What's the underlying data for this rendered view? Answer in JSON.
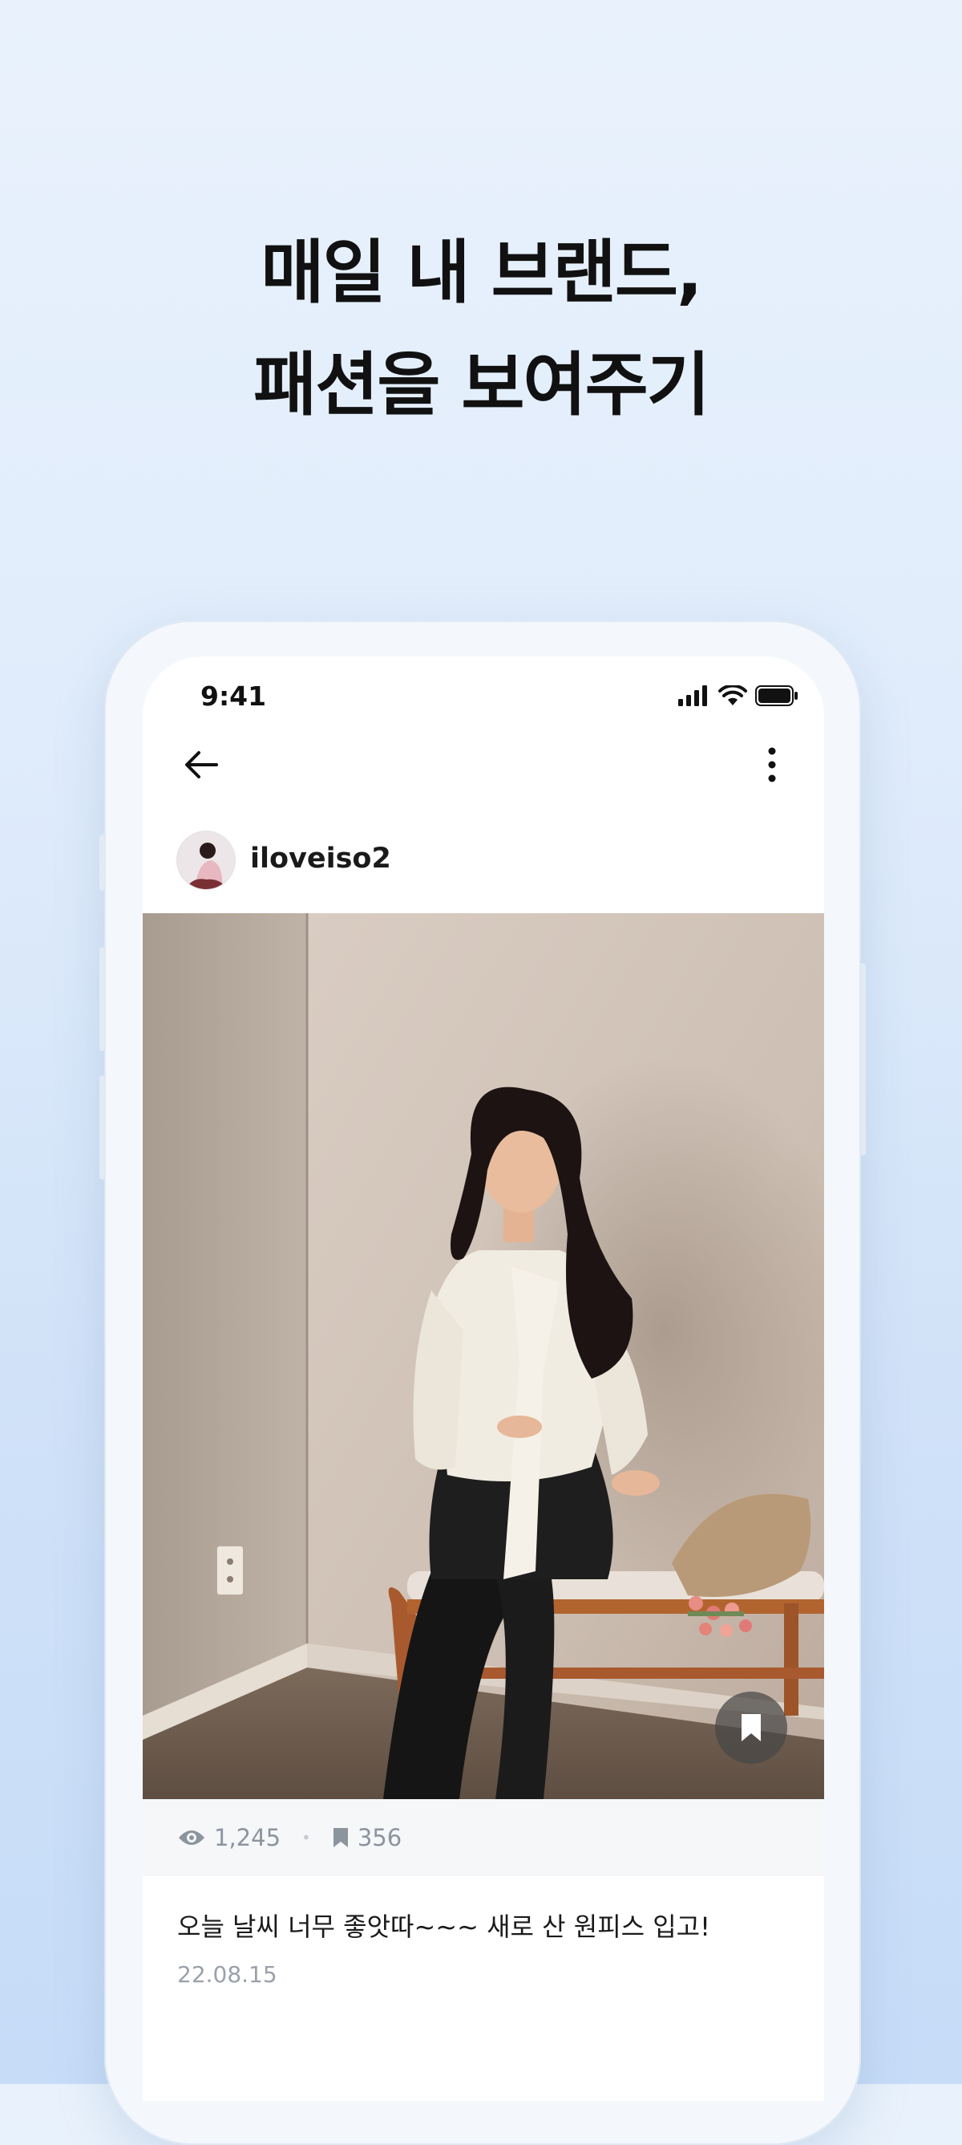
{
  "headline": {
    "line1": "매일 내 브랜드,",
    "line2": "패션을 보여주기"
  },
  "status_bar": {
    "time": "9:41",
    "icons": [
      "signal-icon",
      "wifi-icon",
      "battery-icon"
    ]
  },
  "nav": {
    "back_icon": "arrow-left-icon",
    "more_icon": "more-vertical-icon"
  },
  "post": {
    "username": "iloveiso2",
    "views": "1,245",
    "bookmarks": "356",
    "caption": "오늘 날씨 너무 좋앗따~~~ 새로 산 원피스 입고!",
    "date": "22.08.15"
  },
  "colors": {
    "background": "#e0ecfb",
    "headline_text": "#111111",
    "muted_text": "#8c949e",
    "stats_bg": "#f6f7f9"
  }
}
